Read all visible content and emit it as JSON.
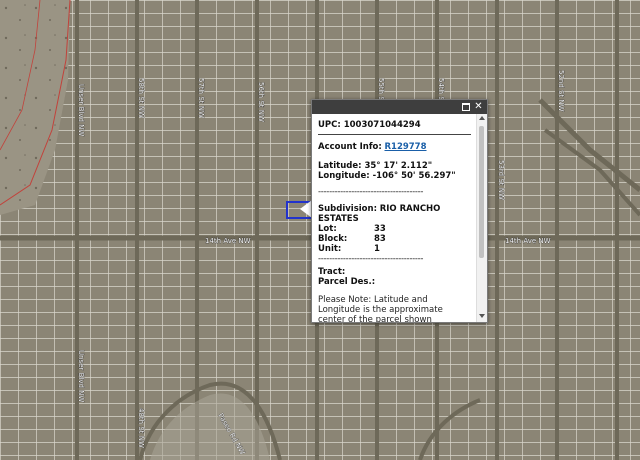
{
  "map": {
    "colors": {
      "ground": "#8b8575",
      "road": "#6e6959",
      "parcel": "#d9d6cc",
      "boundary": "#c2423b",
      "selection": "#2233cc"
    },
    "street_labels": {
      "s1": "14th Ave NW",
      "s2": "14th Ave NW",
      "s3": "58th St NW",
      "s4": "57th St NW",
      "s5": "56th St NW",
      "s6": "55th St NW",
      "s7": "54th St NW",
      "s8": "53rd St NW",
      "s9": "52nd St NW",
      "s10": "Unser Blvd NW",
      "s11": "Unser Blvd NW",
      "s12": "48th St NW",
      "s13": "Paseo Rd NW"
    }
  },
  "popup": {
    "upc": "UPC: 1003071044294",
    "account_label": "Account Info:",
    "account_link": "R129778",
    "latitude": "Latitude: 35° 17' 2.112\"",
    "longitude": "Longitude: -106° 50' 56.297\"",
    "separator": "--------------------------------------",
    "subdivision_label": "Subdivision:",
    "subdivision_value": "RIO RANCHO ESTATES",
    "lot_label": "Lot:",
    "lot_value": "33",
    "block_label": "Block:",
    "block_value": "83",
    "unit_label": "Unit:",
    "unit_value": "1",
    "tract_label": "Tract:",
    "parcel_label": "Parcel Des.:",
    "note": "Please Note: Latitude and Longitude is the approximate center of the parcel shown"
  }
}
